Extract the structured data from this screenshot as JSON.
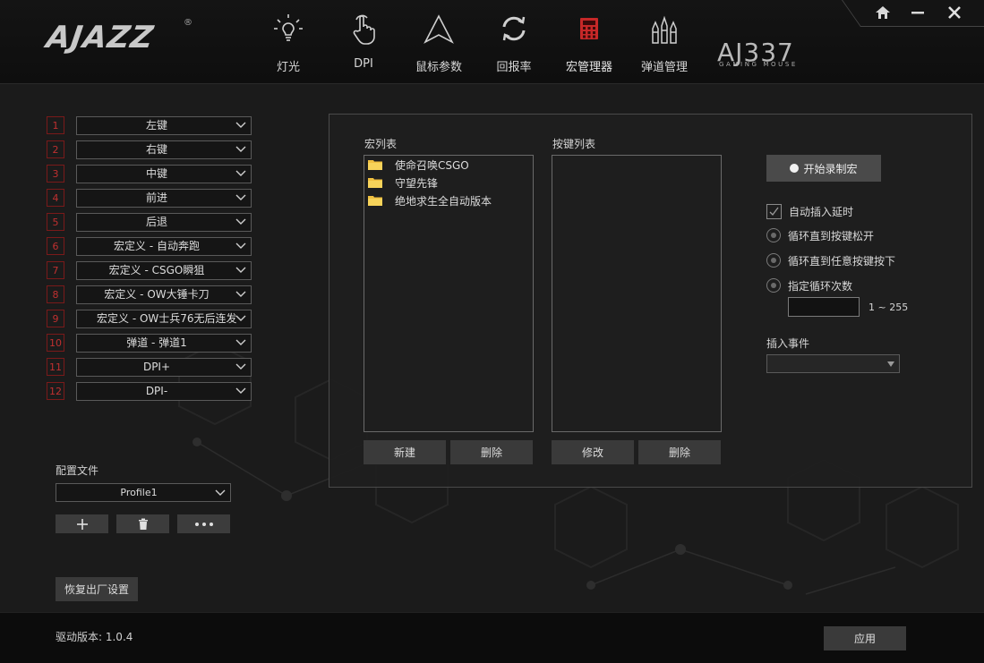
{
  "brand": {
    "logo": "AJAZZ",
    "registered": "®",
    "model": "AJ337",
    "model_sub": "GAMING MOUSE"
  },
  "colors": {
    "accent": "#c62828",
    "panel_bg": "#1e1e1e",
    "button_bg": "#3a3a3a"
  },
  "nav": [
    {
      "label": "灯光",
      "icon": "bulb-icon"
    },
    {
      "label": "DPI",
      "icon": "hand-pointer-icon"
    },
    {
      "label": "鼠标参数",
      "icon": "triangle-icon"
    },
    {
      "label": "回报率",
      "icon": "refresh-icon"
    },
    {
      "label": "宏管理器",
      "icon": "calculator-icon",
      "active": true
    },
    {
      "label": "弹道管理",
      "icon": "bullets-icon"
    }
  ],
  "window_controls": [
    "home-icon",
    "minimize-icon",
    "close-icon"
  ],
  "keys": [
    {
      "num": "1",
      "value": "左键"
    },
    {
      "num": "2",
      "value": "右键"
    },
    {
      "num": "3",
      "value": "中键"
    },
    {
      "num": "4",
      "value": "前进"
    },
    {
      "num": "5",
      "value": "后退"
    },
    {
      "num": "6",
      "value": "宏定义 - 自动奔跑"
    },
    {
      "num": "7",
      "value": "宏定义 - CSGO瞬狙"
    },
    {
      "num": "8",
      "value": "宏定义 - OW大锤卡刀"
    },
    {
      "num": "9",
      "value": "宏定义 - OW士兵76无后连发"
    },
    {
      "num": "10",
      "value": "弹道 - 弹道1"
    },
    {
      "num": "11",
      "value": "DPI+"
    },
    {
      "num": "12",
      "value": "DPI-"
    }
  ],
  "profile": {
    "label": "配置文件",
    "value": "Profile1"
  },
  "reset_label": "恢复出厂设置",
  "macro": {
    "list_label": "宏列表",
    "items": [
      "使命召唤CSGO",
      "守望先锋",
      "绝地求生全自动版本"
    ],
    "new_label": "新建",
    "delete_label": "删除",
    "keylist_label": "按键列表",
    "edit_label": "修改",
    "delete2_label": "删除"
  },
  "record": {
    "button_label": "开始录制宏",
    "auto_delay": "自动插入延时",
    "loop_release": "循环直到按键松开",
    "loop_any": "循环直到任意按键按下",
    "loop_count": "指定循环次数",
    "count_value": "",
    "range": "1 ~ 255",
    "insert_event": "插入事件",
    "event_value": ""
  },
  "footer": {
    "version": "驱动版本: 1.0.4",
    "apply_label": "应用"
  }
}
